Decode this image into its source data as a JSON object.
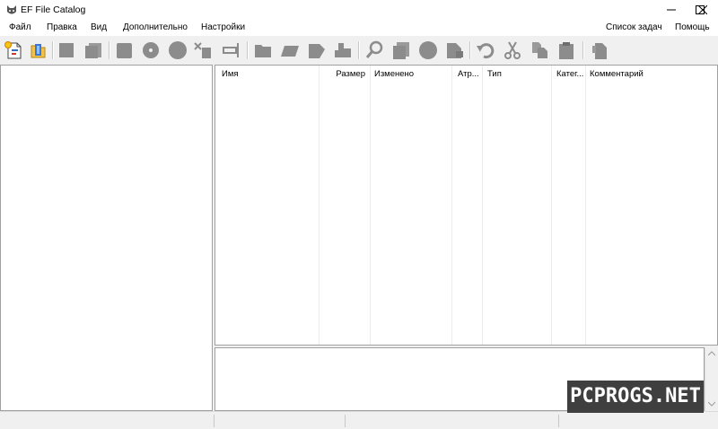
{
  "window": {
    "title": "EF File Catalog"
  },
  "menu": {
    "left": [
      "Файл",
      "Правка",
      "Вид",
      "Дополнительно",
      "Настройки"
    ],
    "right": [
      "Список задач",
      "Помощь"
    ]
  },
  "list": {
    "columns": [
      "Имя",
      "Размер",
      "Изменено",
      "Атр...",
      "Тип",
      "Катег...",
      "Комментарий"
    ]
  },
  "watermark": {
    "text": "PCPROGS.NET"
  },
  "colors": {
    "icon_gray": "#8c8c8c",
    "icon_disabled": "#9a9a9a",
    "watermark_bg": "#3f3f3f",
    "border": "#a0a0a0"
  },
  "toolbar_icons": [
    "new-catalog-icon",
    "open-catalog-icon",
    "stop-icon",
    "copy-pages-icon",
    "scan-icon",
    "disk-icon",
    "disc-icon",
    "cut-tool-icon",
    "rename-icon",
    "folder-icon",
    "folder-open-icon",
    "tag-icon",
    "puzzle-icon",
    "search-icon",
    "pages-icon",
    "circle-icon",
    "export-icon",
    "undo-icon",
    "scissors-icon",
    "copy-icon",
    "paste-icon",
    "properties-icon"
  ]
}
